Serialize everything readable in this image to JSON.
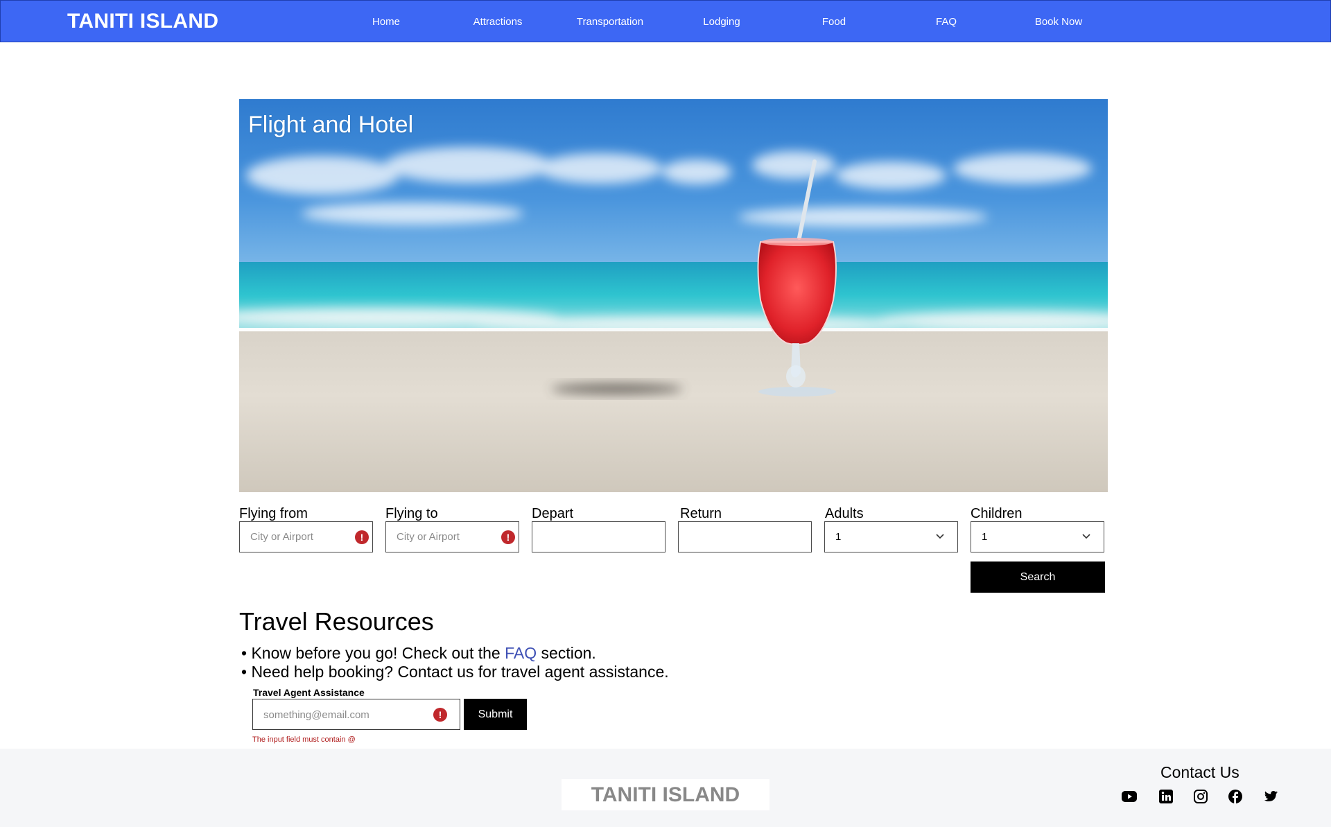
{
  "header": {
    "brand": "TANITI ISLAND",
    "nav": [
      "Home",
      "Attractions",
      "Transportation",
      "Lodging",
      "Food",
      "FAQ",
      "Book Now"
    ],
    "background_color": "#3d67f4"
  },
  "hero": {
    "title": "Flight and Hotel"
  },
  "booking": {
    "flying_from": {
      "label": "Flying from",
      "placeholder": "City or Airport"
    },
    "flying_to": {
      "label": "Flying to",
      "placeholder": "City or Airport"
    },
    "depart": {
      "label": "Depart"
    },
    "return": {
      "label": "Return"
    },
    "adults": {
      "label": "Adults",
      "value": "1"
    },
    "children": {
      "label": "Children",
      "value": "1"
    },
    "search_label": "Search"
  },
  "resources": {
    "title": "Travel Resources",
    "line1_prefix": "• Know before you go! Check out the ",
    "line1_link": "FAQ",
    "line1_suffix": " section.",
    "line2": "• Need help booking? Contact us for travel agent assistance.",
    "assist_label": "Travel Agent Assistance",
    "email_placeholder": "something@email.com",
    "submit_label": "Submit",
    "error_message": "The input field must contain @"
  },
  "footer": {
    "brand": "TANITI ISLAND",
    "contact_title": "Contact Us",
    "social_icons": [
      "youtube-icon",
      "linkedin-icon",
      "instagram-icon",
      "facebook-icon",
      "twitter-icon"
    ]
  },
  "colors": {
    "error": "#c0282c",
    "link": "#3f51b5",
    "footer_background": "#f5f6f8"
  }
}
